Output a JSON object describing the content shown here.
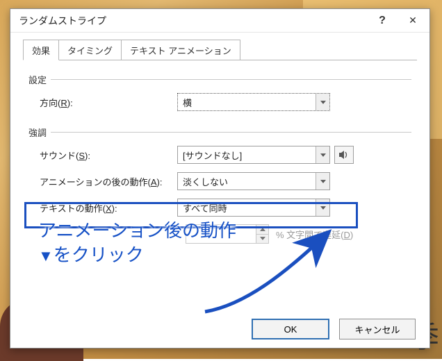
{
  "bg": {
    "corner_char": "季"
  },
  "dialog": {
    "title": "ランダムストライプ",
    "help_glyph": "?",
    "close_glyph": "✕"
  },
  "tabs": {
    "effect": "効果",
    "timing": "タイミング",
    "text_anim": "テキスト アニメーション"
  },
  "group_settings": {
    "label": "設定",
    "direction_label_pre": "方向(",
    "direction_key": "R",
    "direction_label_post": "):",
    "direction_value": "横"
  },
  "group_emphasis": {
    "label": "強調",
    "sound_label_pre": "サウンド(",
    "sound_key": "S",
    "sound_label_post": "):",
    "sound_value": "[サウンドなし]",
    "after_label_pre": "アニメーションの後の動作(",
    "after_key": "A",
    "after_label_post": "):",
    "after_value": "淡くしない",
    "textmove_label_pre": "テキストの動作(",
    "textmove_key": "X",
    "textmove_label_post": "):",
    "textmove_value": "すべて同時",
    "delay_value": "",
    "delay_label_pre": "% 文字間で遅延(",
    "delay_key": "D",
    "delay_label_post": ")"
  },
  "footer": {
    "ok": "OK",
    "cancel": "キャンセル"
  },
  "annotation": {
    "line1": "アニメーション後の動作",
    "line2_pre": "▼",
    "line2_post": "をクリック"
  }
}
